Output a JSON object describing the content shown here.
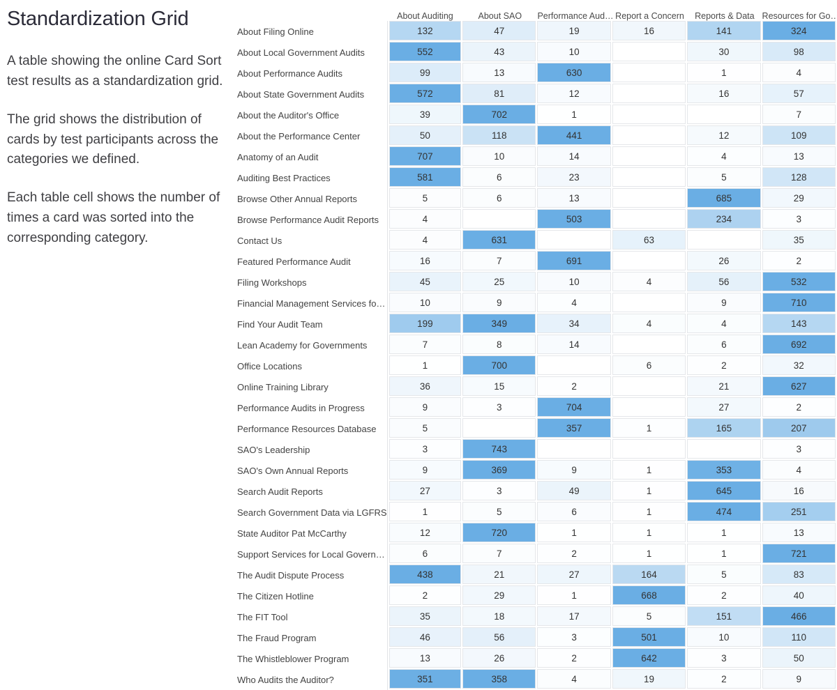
{
  "title": "Standardization Grid",
  "description": [
    "A table showing the online Card Sort test results as a standardization grid.",
    "The grid shows the distribution of cards by test participants across the categories we defined.",
    "Each table cell shows the number of times a card was sorted into the corresponding category."
  ],
  "colors": {
    "cell_max": "#6aaee4",
    "cell_min": "#ffffff",
    "border": "#e4e6e9",
    "text": "#333333"
  },
  "chart_data": {
    "type": "heatmap",
    "title": "Standardization Grid",
    "xlabel": "",
    "ylabel": "",
    "grid": true,
    "legend_position": "none",
    "colorscale": [
      "#ffffff",
      "#6aaee4"
    ],
    "value_range": [
      0,
      743
    ],
    "categories": [
      "About Auditing",
      "About SAO",
      "Performance Aud…",
      "Report a Concern",
      "Reports & Data",
      "Resources for Go…"
    ],
    "rows": [
      "About Filing Online",
      "About Local Government Audits",
      "About Performance Audits",
      "About State Government Audits",
      "About the Auditor's Office",
      "About the Performance Center",
      "Anatomy of an Audit",
      "Auditing Best Practices",
      "Browse Other Annual Reports",
      "Browse Performance Audit Reports",
      "Contact Us",
      "Featured Performance Audit",
      "Filing Workshops",
      "Financial Management Services fo…",
      "Find Your Audit Team",
      "Lean Academy for Governments",
      "Office Locations",
      "Online Training Library",
      "Performance Audits in Progress",
      "Performance Resources Database",
      "SAO's Leadership",
      "SAO's Own Annual Reports",
      "Search Audit Reports",
      "Search Government Data via LGFRS",
      "State Auditor Pat McCarthy",
      "Support Services for Local Govern…",
      "The Audit Dispute Process",
      "The Citizen Hotline",
      "The FIT Tool",
      "The Fraud Program",
      "The Whistleblower Program",
      "Who Audits the Auditor?"
    ],
    "values": [
      [
        132,
        47,
        19,
        16,
        141,
        324
      ],
      [
        552,
        43,
        10,
        null,
        30,
        98
      ],
      [
        99,
        13,
        630,
        null,
        1,
        4
      ],
      [
        572,
        81,
        12,
        null,
        16,
        57
      ],
      [
        39,
        702,
        1,
        null,
        null,
        7
      ],
      [
        50,
        118,
        441,
        null,
        12,
        109
      ],
      [
        707,
        10,
        14,
        null,
        4,
        13
      ],
      [
        581,
        6,
        23,
        null,
        5,
        128
      ],
      [
        5,
        6,
        13,
        null,
        685,
        29
      ],
      [
        4,
        null,
        503,
        null,
        234,
        3
      ],
      [
        4,
        631,
        null,
        63,
        null,
        35
      ],
      [
        16,
        7,
        691,
        null,
        26,
        2
      ],
      [
        45,
        25,
        10,
        4,
        56,
        532
      ],
      [
        10,
        9,
        4,
        null,
        9,
        710
      ],
      [
        199,
        349,
        34,
        4,
        4,
        143
      ],
      [
        7,
        8,
        14,
        null,
        6,
        692
      ],
      [
        1,
        700,
        null,
        6,
        2,
        32
      ],
      [
        36,
        15,
        2,
        null,
        21,
        627
      ],
      [
        9,
        3,
        704,
        null,
        27,
        2
      ],
      [
        5,
        null,
        357,
        1,
        165,
        207
      ],
      [
        3,
        743,
        null,
        null,
        null,
        3
      ],
      [
        9,
        369,
        9,
        1,
        353,
        4
      ],
      [
        27,
        3,
        49,
        1,
        645,
        16
      ],
      [
        1,
        5,
        6,
        1,
        474,
        251
      ],
      [
        12,
        720,
        1,
        1,
        1,
        13
      ],
      [
        6,
        7,
        2,
        1,
        1,
        721
      ],
      [
        438,
        21,
        27,
        164,
        5,
        83
      ],
      [
        2,
        29,
        1,
        668,
        2,
        40
      ],
      [
        35,
        18,
        17,
        5,
        151,
        466
      ],
      [
        46,
        56,
        3,
        501,
        10,
        110
      ],
      [
        13,
        26,
        2,
        642,
        3,
        50
      ],
      [
        351,
        358,
        4,
        19,
        2,
        9
      ]
    ]
  }
}
